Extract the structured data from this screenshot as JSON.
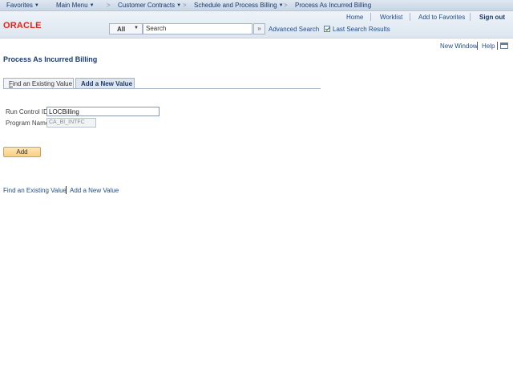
{
  "breadcrumb": {
    "items": [
      "Favorites",
      "Main Menu",
      "Customer Contracts",
      "Schedule and Process Billing",
      "Process As Incurred Billing"
    ],
    "separator": ">"
  },
  "header": {
    "logo": "ORACLE",
    "links": [
      "Home",
      "Worklist",
      "Add to Favorites",
      "Sign out"
    ],
    "search": {
      "scope": "All",
      "value": "Search",
      "go_label": "»",
      "advanced_label": "Advanced Search",
      "last_results_label": "Last Search Results"
    }
  },
  "utility": {
    "new_window": "New Window",
    "help": "Help"
  },
  "page": {
    "title": "Process As Incurred Billing"
  },
  "tabs": {
    "find_prefix": "F",
    "find_rest": "ind an Existing Value",
    "add": "Add a New Value"
  },
  "form": {
    "run_control_label": "Run Control ID",
    "run_control_value": "LOCBilling",
    "program_name_label": "Program Name",
    "program_name_value": "CA_BI_INTFC",
    "add_button": "Add"
  },
  "bottom_links": {
    "find": "Find an Existing Value",
    "add": "Add a New Value"
  },
  "colors": {
    "brand_red": "#e2231a",
    "link_blue": "#1f4d8c",
    "button_orange": "#f6cf85"
  }
}
